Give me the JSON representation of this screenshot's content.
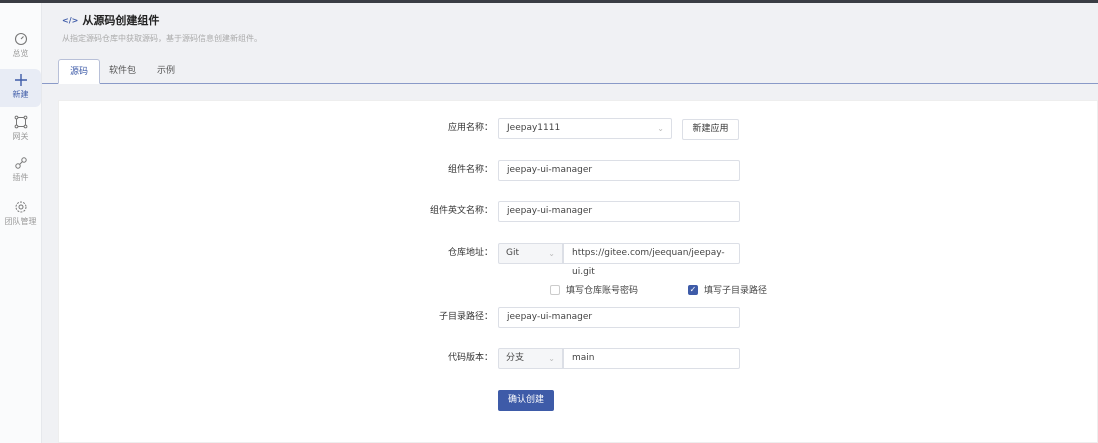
{
  "sidebar": {
    "items": [
      {
        "label": "总览",
        "icon": "dashboard-icon"
      },
      {
        "label": "新建",
        "icon": "plus-icon"
      },
      {
        "label": "网关",
        "icon": "gateway-icon"
      },
      {
        "label": "插件",
        "icon": "plugin-icon"
      },
      {
        "label": "团队管理",
        "icon": "gear-icon"
      }
    ]
  },
  "header": {
    "icon": "</>",
    "title": "从源码创建组件",
    "subtitle": "从指定源码仓库中获取源码，基于源码信息创建新组件。"
  },
  "tabs": [
    "源码",
    "软件包",
    "示例"
  ],
  "form": {
    "app_label": "应用名称：",
    "app_value": "Jeepay1111",
    "new_app": "新建应用",
    "name_label": "组件名称：",
    "name_value": "jeepay-ui-manager",
    "en_label": "组件英文名称：",
    "en_value": "jeepay-ui-manager",
    "repo_label": "仓库地址：",
    "repo_type": "Git",
    "repo_value": "https://gitee.com/jeequan/jeepay-ui.git",
    "cb_account": "填写仓库账号密码",
    "cb_subdir": "填写子目录路径",
    "cb_account_checked": false,
    "cb_subdir_checked": true,
    "subdir_label": "子目录路径：",
    "subdir_value": "jeepay-ui-manager",
    "version_label": "代码版本：",
    "version_type": "分支",
    "version_value": "main",
    "submit": "确认创建"
  },
  "colors": {
    "accent": "#3e5ba8"
  }
}
